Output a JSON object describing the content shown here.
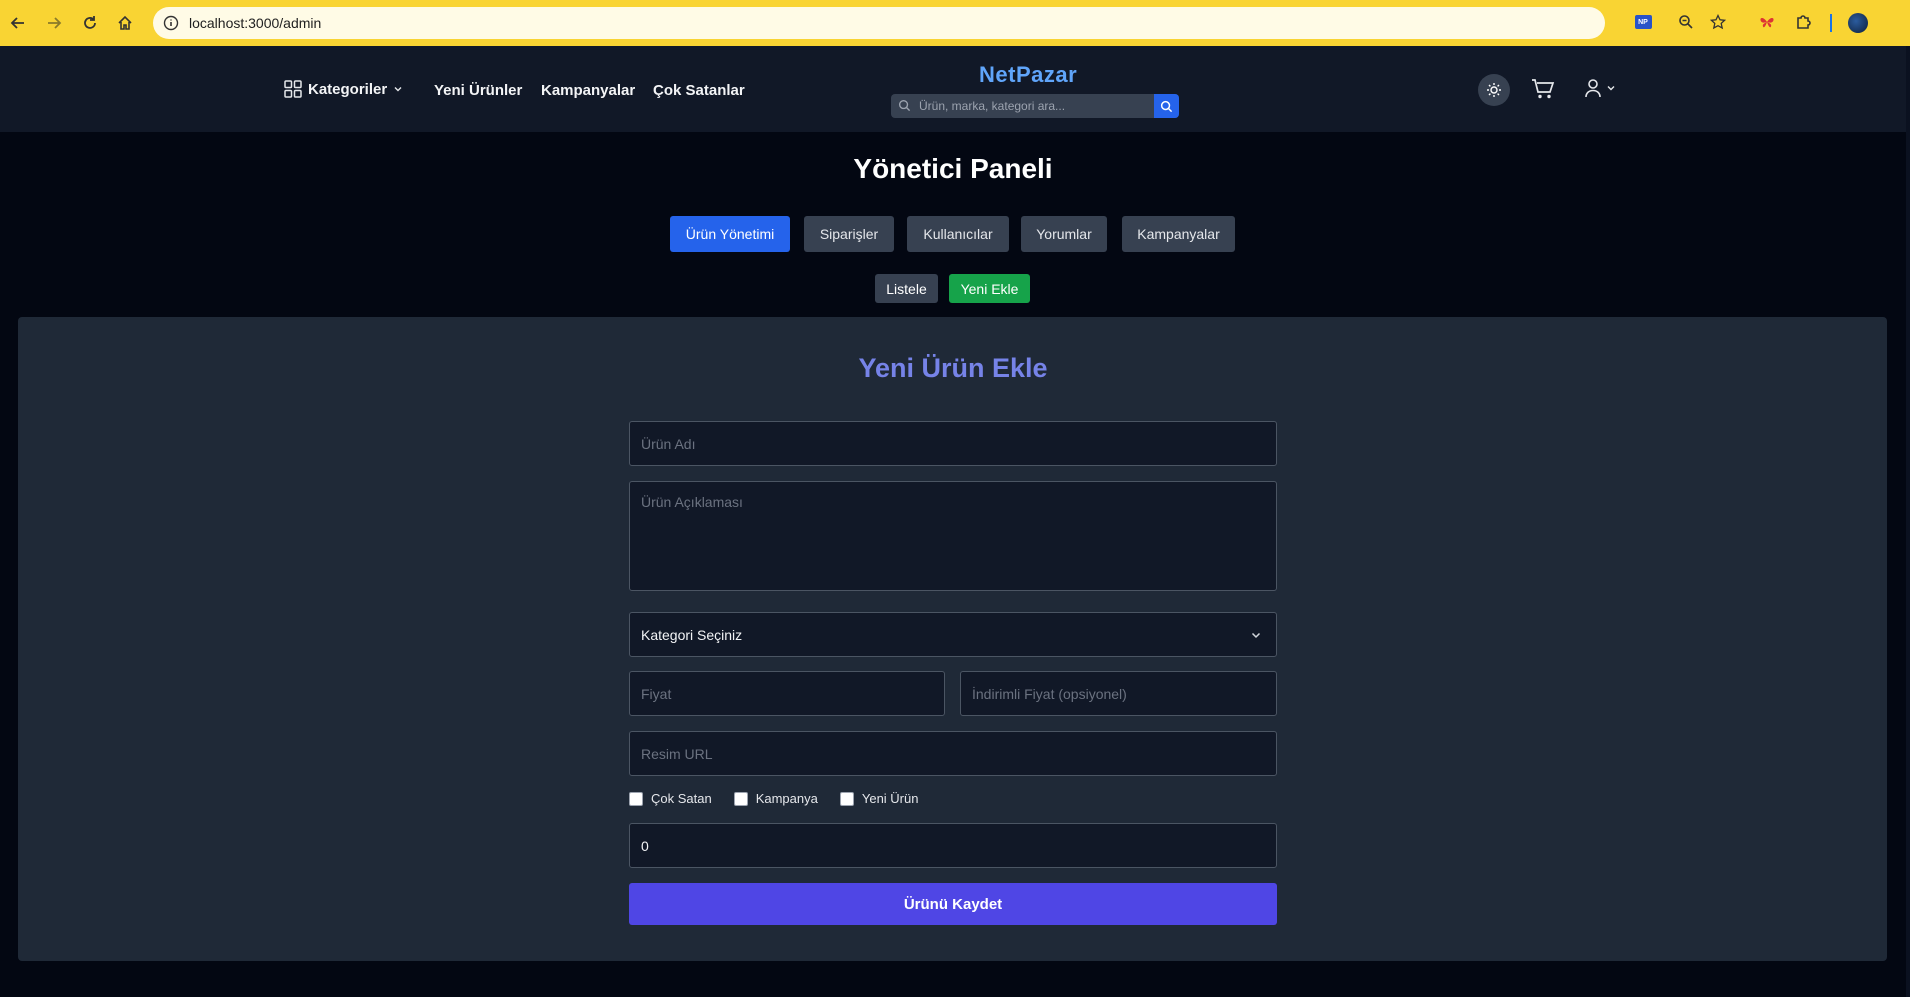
{
  "browser": {
    "url": "localhost:3000/admin",
    "extension_badge": "NP"
  },
  "header": {
    "categories_label": "Kategoriler",
    "nav_links": [
      "Yeni Ürünler",
      "Kampanyalar",
      "Çok Satanlar"
    ],
    "brand": "NetPazar",
    "search_placeholder": "Ürün, marka, kategori ara..."
  },
  "admin": {
    "title": "Yönetici Paneli",
    "tabs": [
      "Ürün Yönetimi",
      "Siparişler",
      "Kullanıcılar",
      "Yorumlar",
      "Kampanyalar"
    ],
    "active_tab": "Ürün Yönetimi",
    "subtabs": [
      "Listele",
      "Yeni Ekle"
    ]
  },
  "form": {
    "title": "Yeni Ürün Ekle",
    "name_placeholder": "Ürün Adı",
    "description_placeholder": "Ürün Açıklaması",
    "category_selected": "Kategori Seçiniz",
    "price_placeholder": "Fiyat",
    "discount_placeholder": "İndirimli Fiyat (opsiyonel)",
    "image_placeholder": "Resim URL",
    "checkboxes": [
      "Çok Satan",
      "Kampanya",
      "Yeni Ürün"
    ],
    "stock_value": "0",
    "save_label": "Ürünü Kaydet"
  },
  "colors": {
    "browser_bar": "#f9d433",
    "header_bg": "#111827",
    "page_bg": "#030712",
    "accent_blue": "#2563eb",
    "success_green": "#16a34a",
    "save_indigo": "#4f46e5",
    "form_title": "#7683e8"
  }
}
